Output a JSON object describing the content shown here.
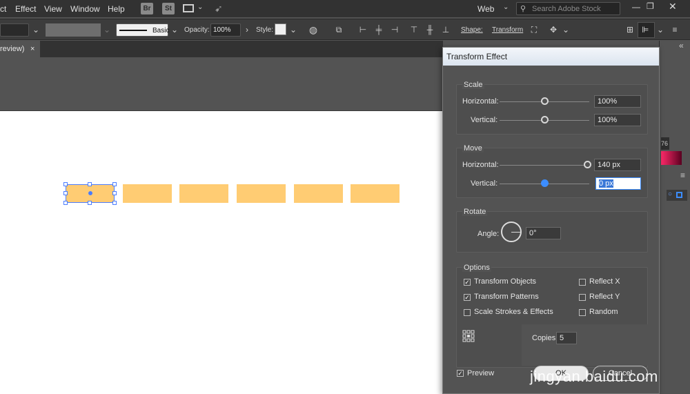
{
  "menubar": {
    "items": [
      "ct",
      "Effect",
      "View",
      "Window",
      "Help"
    ],
    "bridge": "Br",
    "stock": "St",
    "workspace": "Web",
    "search_placeholder": "Search Adobe Stock"
  },
  "controlbar": {
    "stroke_style": "Basic",
    "opacity_label": "Opacity:",
    "opacity_value": "100%",
    "style_label": "Style:",
    "shape_label": "Shape:",
    "transform_label": "Transform"
  },
  "tab": {
    "label": "review)",
    "close": "×"
  },
  "dialog": {
    "title": "Transform Effect",
    "scale": {
      "title": "Scale",
      "horizontal_label": "Horizontal:",
      "horizontal_value": "100%",
      "horizontal_pct": 50,
      "vertical_label": "Vertical:",
      "vertical_value": "100%",
      "vertical_pct": 50
    },
    "move": {
      "title": "Move",
      "horizontal_label": "Horizontal:",
      "horizontal_value": "140 px",
      "vertical_label": "Vertical:",
      "vertical_value": "0 px"
    },
    "rotate": {
      "title": "Rotate",
      "angle_label": "Angle:",
      "angle_value": "0°"
    },
    "options": {
      "title": "Options",
      "transform_objects": "Transform Objects",
      "transform_patterns": "Transform Patterns",
      "scale_strokes": "Scale Strokes & Effects",
      "reflect_x": "Reflect X",
      "reflect_y": "Reflect Y",
      "random": "Random",
      "copies_label": "Copies",
      "copies_value": "5"
    },
    "preview_label": "Preview",
    "ok_label": "OK",
    "cancel_label": "Cancel"
  },
  "right_panel": {
    "value": "76"
  },
  "watermark": "jingyan.baidu.com",
  "colors": {
    "shape_fill": "#ffcc73",
    "selection": "#4a7cff",
    "accent": "#3c8dff"
  }
}
